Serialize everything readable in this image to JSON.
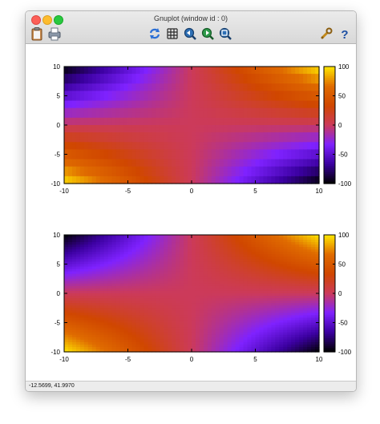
{
  "window": {
    "title": "Gnuplot (window id : 0)"
  },
  "toolbar": {
    "copy_icon": "clipboard-icon",
    "print_icon": "print-icon",
    "replot_icon": "replot-icon",
    "grid_icon": "grid-icon",
    "zoom_prev_icon": "zoom-previous-icon",
    "zoom_next_icon": "zoom-next-icon",
    "unzoom_icon": "unzoom-icon",
    "settings_icon": "wrench-icon",
    "help_icon": "help-icon"
  },
  "status": {
    "coordinates": "-12.5699, 41.9970"
  },
  "colors": {
    "palette": [
      "#000000",
      "#3b00a0",
      "#7f22ff",
      "#cc3a5a",
      "#d04700",
      "#e06c00",
      "#ffe800"
    ]
  },
  "chart_data": [
    {
      "type": "heatmap",
      "title": "",
      "xlabel": "",
      "ylabel": "",
      "xlim": [
        -10,
        10
      ],
      "ylim": [
        -10,
        10
      ],
      "xticks": [
        "-10",
        "-5",
        "0",
        "5",
        "10"
      ],
      "yticks": [
        "10",
        "5",
        "0",
        "-5",
        "-10"
      ],
      "colorbar": {
        "range": [
          -100,
          100
        ],
        "ticks": [
          "100",
          "50",
          "0",
          "-50",
          "-100"
        ]
      },
      "x": [
        -10,
        -5,
        0,
        5,
        10
      ],
      "y": [
        10,
        5,
        0,
        -5,
        -10
      ],
      "values": [
        [
          -100,
          -50,
          0,
          50,
          100
        ],
        [
          -50,
          -25,
          0,
          25,
          50
        ],
        [
          0,
          0,
          0,
          0,
          0
        ],
        [
          50,
          25,
          0,
          -25,
          -50
        ],
        [
          100,
          50,
          0,
          -50,
          -100
        ]
      ],
      "y_steps": 14
    },
    {
      "type": "heatmap",
      "title": "",
      "xlabel": "",
      "ylabel": "",
      "xlim": [
        -10,
        10
      ],
      "ylim": [
        -10,
        10
      ],
      "xticks": [
        "-10",
        "-5",
        "0",
        "5",
        "10"
      ],
      "yticks": [
        "10",
        "5",
        "0",
        "-5",
        "-10"
      ],
      "colorbar": {
        "range": [
          -100,
          100
        ],
        "ticks": [
          "100",
          "50",
          "0",
          "-50",
          "-100"
        ]
      },
      "x": [
        -10,
        -5,
        0,
        5,
        10
      ],
      "y": [
        10,
        5,
        0,
        -5,
        -10
      ],
      "values": [
        [
          -100,
          -50,
          0,
          50,
          100
        ],
        [
          -50,
          -25,
          0,
          25,
          50
        ],
        [
          0,
          0,
          0,
          0,
          0
        ],
        [
          50,
          25,
          0,
          -25,
          -50
        ],
        [
          100,
          50,
          0,
          -50,
          -100
        ]
      ],
      "y_steps": 0
    }
  ]
}
